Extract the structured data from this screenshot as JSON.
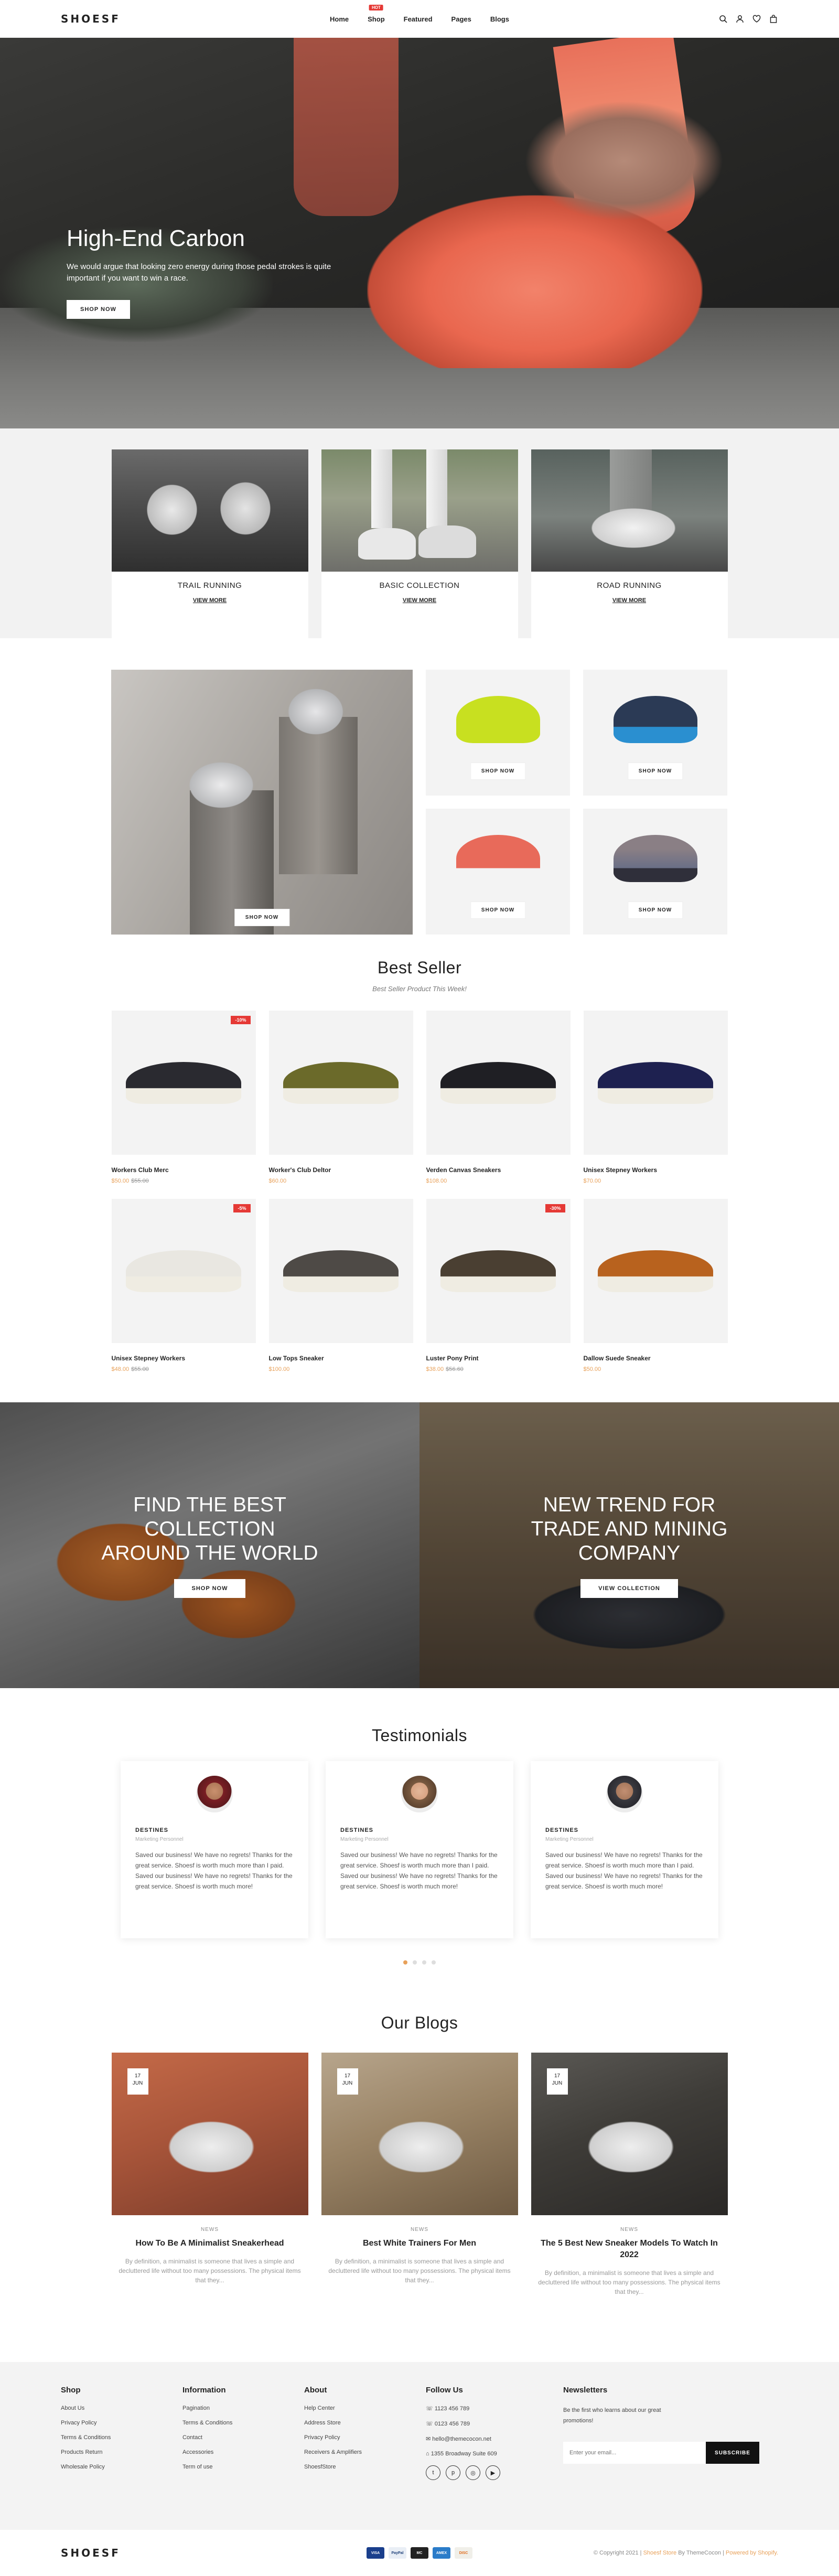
{
  "header": {
    "logo": "SHOESF",
    "nav": [
      {
        "label": "Home"
      },
      {
        "label": "Shop",
        "badge": "HOT"
      },
      {
        "label": "Featured"
      },
      {
        "label": "Pages"
      },
      {
        "label": "Blogs"
      }
    ],
    "icons": [
      "search-icon",
      "user-icon",
      "heart-icon",
      "cart-icon"
    ]
  },
  "hero": {
    "title": "High-End Carbon",
    "text": "We would argue that looking zero energy during those pedal strokes is quite important if you want to win a race.",
    "button": "SHOP NOW"
  },
  "collections": [
    {
      "title": "TRAIL RUNNING",
      "link": "VIEW MORE"
    },
    {
      "title": "BASIC COLLECTION",
      "link": "VIEW MORE"
    },
    {
      "title": "ROAD RUNNING",
      "link": "VIEW MORE"
    }
  ],
  "promo": {
    "big_button": "SHOP NOW",
    "small_buttons": [
      "SHOP NOW",
      "SHOP NOW",
      "SHOP NOW",
      "SHOP NOW"
    ],
    "shoe_colors": [
      "#c8e020",
      "#2b3a55",
      "#e86a5a",
      "#6a6f86"
    ]
  },
  "bestseller": {
    "title": "Best Seller",
    "subtitle": "Best Seller Product This Week!",
    "products": [
      {
        "name": "Workers Club Merc",
        "price": "$50.00",
        "old_price": "$55.00",
        "badge": "-10%",
        "color": "#2a2a30"
      },
      {
        "name": "Worker's Club Deltor",
        "price": "$60.00",
        "old_price": "",
        "badge": "",
        "color": "#6b6a2a"
      },
      {
        "name": "Verden Canvas Sneakers",
        "price": "$108.00",
        "old_price": "",
        "badge": "",
        "color": "#1f1f24"
      },
      {
        "name": "Unisex Stepney Workers",
        "price": "$70.00",
        "old_price": "",
        "badge": "",
        "color": "#1e2150"
      },
      {
        "name": "Unisex Stepney Workers",
        "price": "$48.00",
        "old_price": "$55.00",
        "badge": "-5%",
        "color": "#e9e7e1"
      },
      {
        "name": "Low Tops Sneaker",
        "price": "$100.00",
        "old_price": "",
        "badge": "",
        "color": "#4e4a46"
      },
      {
        "name": "Luster Pony Print",
        "price": "$38.00",
        "old_price": "$56.60",
        "badge": "-30%",
        "color": "#4a3f32"
      },
      {
        "name": "Dallow Suede Sneaker",
        "price": "$50.00",
        "old_price": "",
        "badge": "",
        "color": "#b8621e"
      }
    ]
  },
  "banners": [
    {
      "title": "FIND THE BEST COLLECTION AROUND THE WORLD",
      "button": "SHOP NOW"
    },
    {
      "title": "NEW TREND FOR TRADE AND MINING COMPANY",
      "button": "VIEW COLLECTION"
    }
  ],
  "testimonials": {
    "title": "Testimonials",
    "items": [
      {
        "name": "DESTINES",
        "role": "Marketing Personnel",
        "text": "Saved our business! We have no regrets! Thanks for the great service. Shoesf is worth much more than I paid. Saved our business! We have no regrets! Thanks for the great service. Shoesf is worth much more!"
      },
      {
        "name": "DESTINES",
        "role": "Marketing Personnel",
        "text": "Saved our business! We have no regrets! Thanks for the great service. Shoesf is worth much more than I paid. Saved our business! We have no regrets! Thanks for the great service. Shoesf is worth much more!"
      },
      {
        "name": "DESTINES",
        "role": "Marketing Personnel",
        "text": "Saved our business! We have no regrets! Thanks for the great service. Shoesf is worth much more than I paid. Saved our business! We have no regrets! Thanks for the great service. Shoesf is worth much more!"
      }
    ]
  },
  "blogs": {
    "title": "Our Blogs",
    "items": [
      {
        "day": "17",
        "month": "JUN",
        "category": "NEWS",
        "title": "How To Be A Minimalist Sneakerhead",
        "excerpt": "By definition, a minimalist is someone that lives a simple and decluttered life without too many possessions. The physical items that they..."
      },
      {
        "day": "17",
        "month": "JUN",
        "category": "NEWS",
        "title": "Best White Trainers For Men",
        "excerpt": "By definition, a minimalist is someone that lives a simple and decluttered life without too many possessions. The physical items that they..."
      },
      {
        "day": "17",
        "month": "JUN",
        "category": "NEWS",
        "title": "The 5 Best New Sneaker Models To Watch In 2022",
        "excerpt": "By definition, a minimalist is someone that lives a simple and decluttered life without too many possessions. The physical items that they..."
      }
    ]
  },
  "footer": {
    "shop": {
      "title": "Shop",
      "links": [
        "About Us",
        "Privacy Policy",
        "Terms & Conditions",
        "Products Return",
        "Wholesale Policy"
      ]
    },
    "information": {
      "title": "Information",
      "links": [
        "Pagination",
        "Terms & Conditions",
        "Contact",
        "Accessories",
        "Term of use"
      ]
    },
    "about": {
      "title": "About",
      "links": [
        "Help Center",
        "Address Store",
        "Privacy Policy",
        "Receivers & Amplifiers",
        "ShoesfStore"
      ]
    },
    "follow": {
      "title": "Follow Us",
      "links": [
        "1123 456 789",
        "0123 456 789",
        "hello@themecocon.net",
        "1355 Broadway Suite 609"
      ]
    },
    "newsletter": {
      "title": "Newsletters",
      "text": "Be the first who learns about our great promotions!",
      "placeholder": "Enter your email...",
      "button": "SUBSCRIBE"
    },
    "bottom_logo": "SHOESF",
    "payments": [
      "VISA",
      "PayPal",
      "MC",
      "AMEX",
      "DISC"
    ],
    "copyright_prefix": "© Copyright 2021 |",
    "copyright_brand": "Shoesf Store",
    "copyright_mid": "By ThemeCocon |",
    "copyright_suffix": "Powered by Shopify."
  }
}
